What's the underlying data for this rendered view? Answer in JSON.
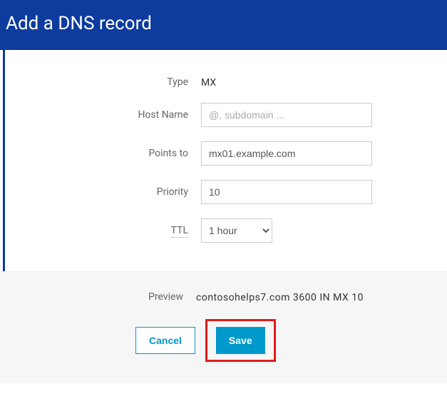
{
  "header": {
    "title": "Add a DNS record"
  },
  "form": {
    "type_label": "Type",
    "type_value": "MX",
    "hostname_label": "Host Name",
    "hostname_placeholder": "@, subdomain ...",
    "hostname_value": "",
    "pointsto_label": "Points to",
    "pointsto_value": "mx01.example.com",
    "priority_label": "Priority",
    "priority_value": "10",
    "ttl_label": "TTL",
    "ttl_selected": "1 hour"
  },
  "footer": {
    "preview_label": "Preview",
    "preview_value": "contosohelps7.com  3600  IN  MX  10",
    "cancel_label": "Cancel",
    "save_label": "Save"
  }
}
